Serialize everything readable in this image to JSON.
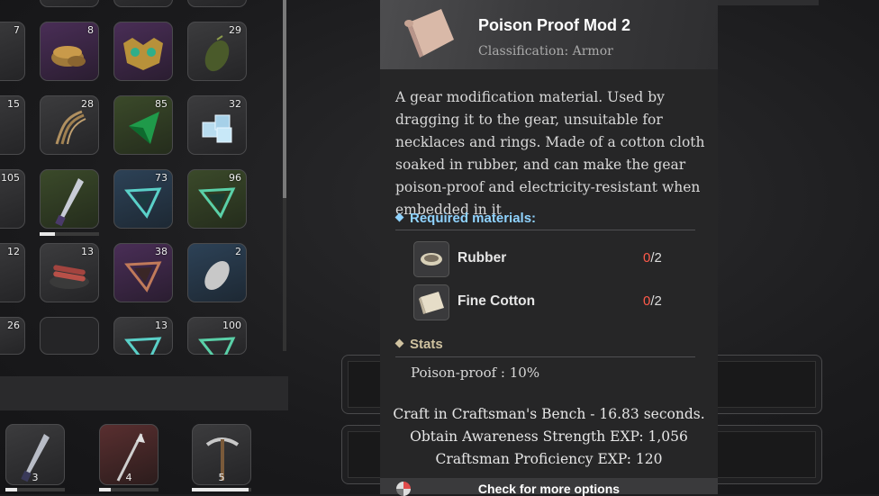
{
  "inventory": {
    "quantities": {
      "r1c0": "7",
      "r1c1": "8",
      "r1c3": "29",
      "r2c0": "15",
      "r2c1": "28",
      "r2c2": "85",
      "r2c3": "32",
      "r3c0": "105",
      "r3c2": "73",
      "r3c3": "96",
      "r4c0": "12",
      "r4c1": "13",
      "r4c2": "38",
      "r4c3": "2",
      "r5c0": "26",
      "r5c2": "13",
      "r5c3": "100"
    },
    "durability": {
      "r3c1": 0.25
    }
  },
  "hotbar": {
    "slots": [
      {
        "number": "3",
        "durability": 0.2
      },
      {
        "number": "4",
        "durability": 0.2
      },
      {
        "number": "5",
        "durability": 0.95
      }
    ]
  },
  "tooltip": {
    "item_name": "Poison Proof Mod 2",
    "classification": "Classification: Armor",
    "description": "A gear modification material. Used by dragging it to the gear, unsuitable for necklaces and rings. Made of a cotton cloth soaked in rubber, and can make the gear poison-proof and electricity-resistant when embedded in it",
    "required_materials_label": "Required materials:",
    "materials": [
      {
        "name": "Rubber",
        "have": "0",
        "need": "/2",
        "icon": "rubber-icon"
      },
      {
        "name": "Fine Cotton",
        "have": "0",
        "need": "/2",
        "icon": "fine-cotton-icon"
      }
    ],
    "stats_label": "Stats",
    "stats": [
      "Poison-proof : 10%"
    ],
    "craft_lines": [
      "Craft in Craftsman's Bench - 16.83 seconds.",
      "Obtain Awareness Strength EXP: 1,056",
      "Craftsman Proficiency EXP: 120"
    ],
    "footer_label": "Check for more options"
  },
  "colors": {
    "required_accent": "#8fd3ff",
    "stats_accent": "#cfc2a0",
    "missing_count": "#ff5a4a"
  }
}
